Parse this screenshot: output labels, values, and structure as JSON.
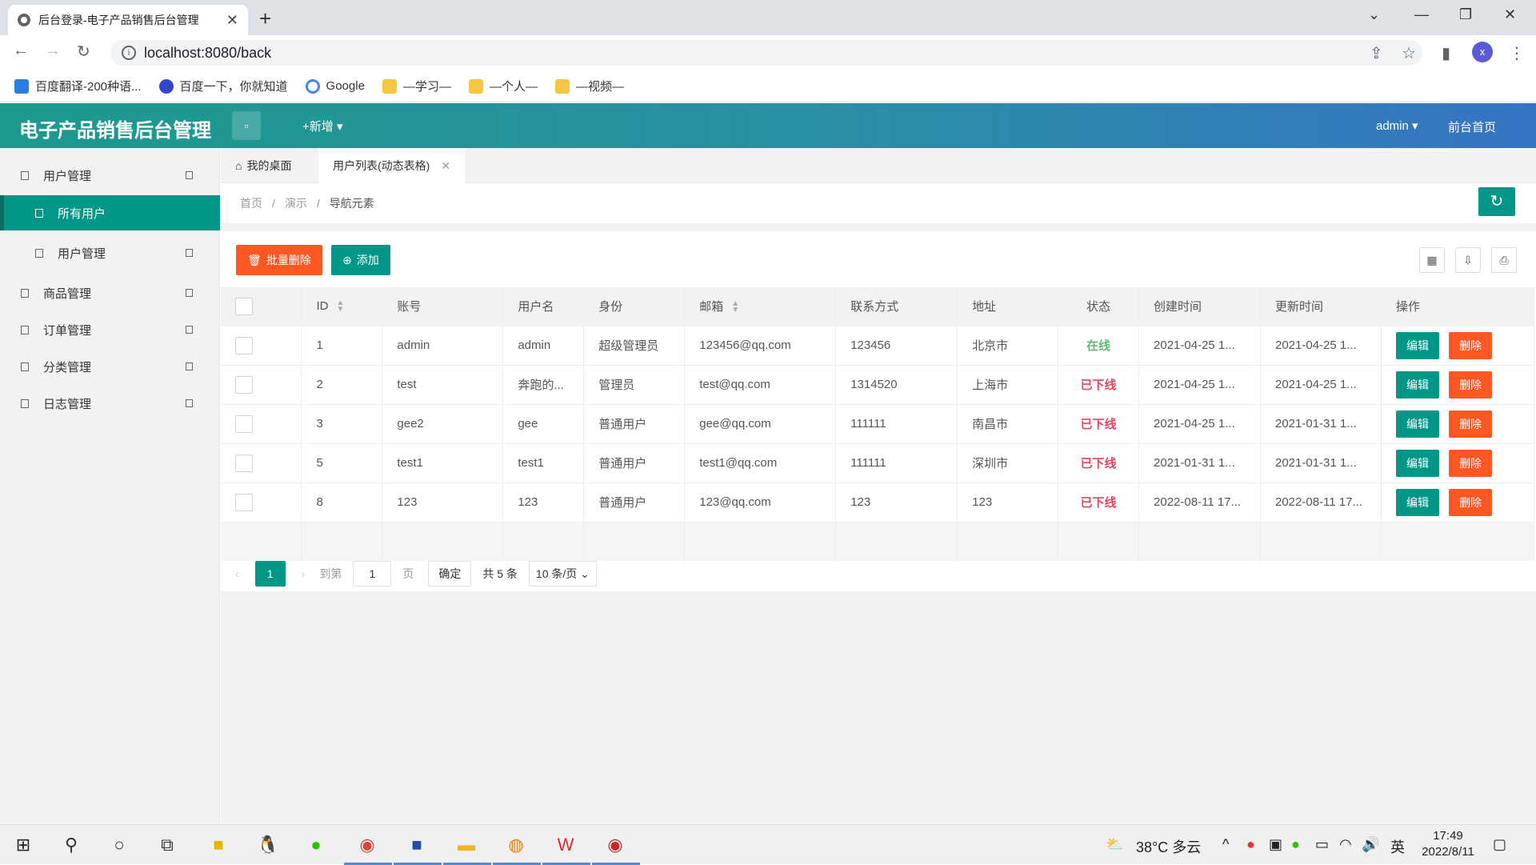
{
  "browser": {
    "tab_title": "后台登录-电子产品销售后台管理",
    "url": "localhost:8080/back",
    "profile": "x",
    "bookmarks": [
      "百度翻译-200种语...",
      "百度一下，你就知道",
      "Google",
      "—学习—",
      "—个人—",
      "—视频—"
    ]
  },
  "header": {
    "title": "电子产品销售后台管理",
    "add_label": "+新增",
    "user": "admin",
    "front_link": "前台首页"
  },
  "sidebar": {
    "items": [
      {
        "label": "用户管理"
      },
      {
        "label": "所有用户"
      },
      {
        "label": "用户管理"
      },
      {
        "label": "商品管理"
      },
      {
        "label": "订单管理"
      },
      {
        "label": "分类管理"
      },
      {
        "label": "日志管理"
      }
    ]
  },
  "tabs": {
    "desk": "我的桌面",
    "current": "用户列表(动态表格)"
  },
  "breadcrumb": {
    "home": "首页",
    "demo": "演示",
    "current": "导航元素",
    "sep": "/"
  },
  "toolbar": {
    "batch_delete": "批量删除",
    "add": "添加"
  },
  "table": {
    "headers": [
      "ID",
      "账号",
      "用户名",
      "身份",
      "邮箱",
      "联系方式",
      "地址",
      "状态",
      "创建时间",
      "更新时间",
      "操作"
    ],
    "rows": [
      {
        "id": "1",
        "account": "admin",
        "username": "admin",
        "role": "超级管理员",
        "email": "123456@qq.com",
        "phone": "123456",
        "address": "北京市",
        "status": "在线",
        "created": "2021-04-25 1...",
        "updated": "2021-04-25 1..."
      },
      {
        "id": "2",
        "account": "test",
        "username": "奔跑的...",
        "role": "管理员",
        "email": "test@qq.com",
        "phone": "1314520",
        "address": "上海市",
        "status": "已下线",
        "created": "2021-04-25 1...",
        "updated": "2021-04-25 1..."
      },
      {
        "id": "3",
        "account": "gee2",
        "username": "gee",
        "role": "普通用户",
        "email": "gee@qq.com",
        "phone": "111111",
        "address": "南昌市",
        "status": "已下线",
        "created": "2021-04-25 1...",
        "updated": "2021-01-31 1..."
      },
      {
        "id": "5",
        "account": "test1",
        "username": "test1",
        "role": "普通用户",
        "email": "test1@qq.com",
        "phone": "111111",
        "address": "深圳市",
        "status": "已下线",
        "created": "2021-01-31 1...",
        "updated": "2021-01-31 1..."
      },
      {
        "id": "8",
        "account": "123",
        "username": "123",
        "role": "普通用户",
        "email": "123@qq.com",
        "phone": "123",
        "address": "123",
        "status": "已下线",
        "created": "2022-08-11 17...",
        "updated": "2022-08-11 17..."
      }
    ],
    "edit_label": "编辑",
    "delete_label": "删除"
  },
  "pager": {
    "current": "1",
    "goto": "到第",
    "input": "1",
    "page": "页",
    "confirm": "确定",
    "total": "共 5 条",
    "size": "10 条/页"
  },
  "taskbar": {
    "weather": "38°C 多云",
    "ime": "英",
    "time": "17:49",
    "date": "2022/8/11"
  },
  "colors": {
    "primary": "#009688",
    "danger": "#ff5722",
    "online": "#5fb878",
    "offline": "#e6475c"
  }
}
